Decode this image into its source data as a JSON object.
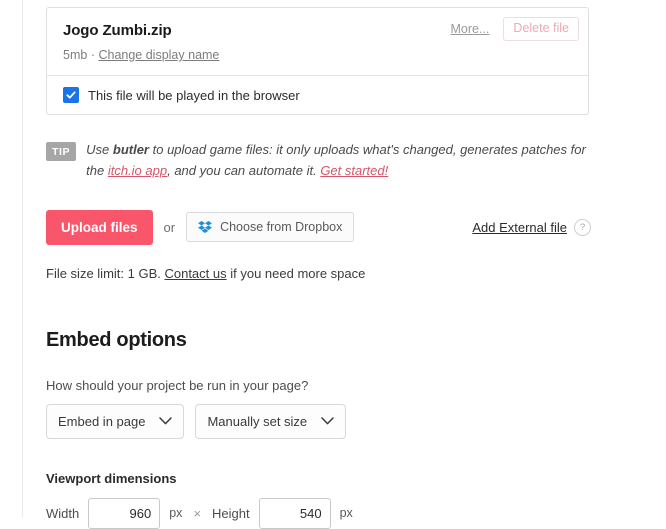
{
  "file_card": {
    "title": "Jogo Zumbi.zip",
    "size": "5mb",
    "separator": "·",
    "change_name_link": "Change display name",
    "more_link": "More...",
    "delete_label": "Delete file",
    "checkbox_label": "This file will be played in the browser",
    "checkbox_checked": true,
    "checkbox_color": "#1a73e8"
  },
  "tip": {
    "badge": "TIP",
    "text_part1": "Use ",
    "bold_word": "butler",
    "text_part2": " to upload game files: it only uploads what's changed, generates patches for the ",
    "link1": "itch.io app",
    "text_part3": ", and you can automate it. ",
    "link2": "Get started!",
    "link_color": "#d4566a"
  },
  "upload": {
    "upload_button": "Upload files",
    "upload_button_color": "#f9566b",
    "or_label": "or",
    "dropbox_button": "Choose from Dropbox",
    "dropbox_icon": "dropbox-icon",
    "dropbox_color": "#1e8fe0",
    "external_link": "Add External file",
    "help_badge": "?",
    "limit_text_part1": "File size limit: 1 GB. ",
    "limit_link": "Contact us",
    "limit_text_part2": " if you need more space"
  },
  "embed": {
    "heading": "Embed options",
    "question": "How should your project be run in your page?",
    "run_mode_value": "Embed in page",
    "size_mode_value": "Manually set size",
    "viewport_heading": "Viewport dimensions",
    "width_label": "Width",
    "width_value": "960",
    "height_label": "Height",
    "height_value": "540",
    "unit": "px",
    "times_symbol": "×"
  }
}
